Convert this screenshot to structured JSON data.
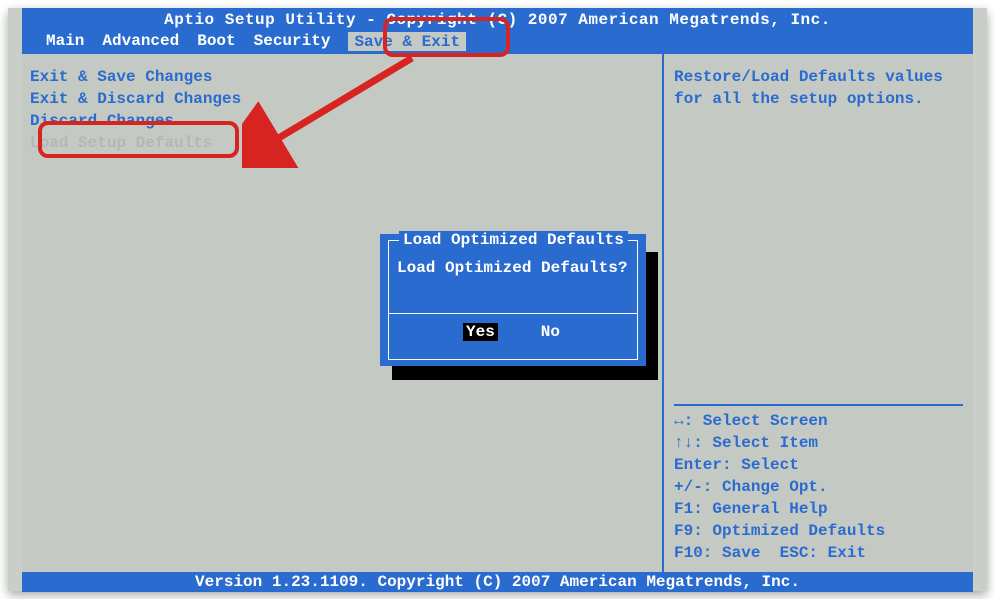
{
  "header": {
    "title": "Aptio Setup Utility - Copyright (C) 2007 American Megatrends, Inc."
  },
  "menus": {
    "items": [
      "Main",
      "Advanced",
      "Boot",
      "Security",
      "Save & Exit"
    ],
    "active_index": 4
  },
  "left_panel": {
    "items": [
      {
        "label": "Exit & Save Changes",
        "disabled": false
      },
      {
        "label": "Exit & Discard Changes",
        "disabled": false
      },
      {
        "label": "Discard Changes",
        "disabled": false
      },
      {
        "label": "Load Setup Defaults",
        "disabled": true
      }
    ]
  },
  "right_panel": {
    "help": [
      "Restore/Load Defaults values",
      "for all the setup options."
    ],
    "hints": [
      "↔: Select Screen",
      "↑↓: Select Item",
      "Enter: Select",
      "+/-: Change Opt.",
      "F1: General Help",
      "F9: Optimized Defaults",
      "F10: Save  ESC: Exit"
    ]
  },
  "dialog": {
    "title": "Load Optimized Defaults",
    "message": "Load Optimized Defaults?",
    "yes": "Yes",
    "no": "No"
  },
  "footer": {
    "text": "Version 1.23.1109. Copyright (C) 2007 American Megatrends, Inc."
  },
  "annotations": {
    "menu_highlight": "Save & Exit",
    "option_highlight": "Load Setup Defaults"
  }
}
